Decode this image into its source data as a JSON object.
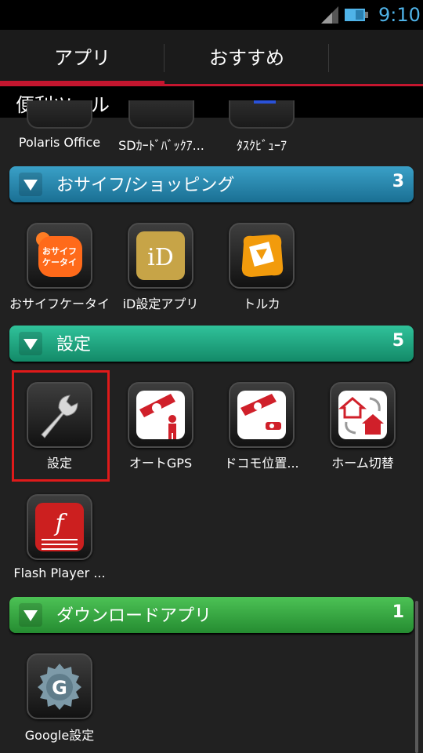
{
  "status": {
    "time": "9:10"
  },
  "tabs": [
    {
      "label": "アプリ"
    },
    {
      "label": "おすすめ"
    }
  ],
  "category_title": "便利ツール",
  "partial_row": [
    {
      "label": "Polaris Office"
    },
    {
      "label": "SDｶｰﾄﾞﾊﾞｯｸｱ..."
    },
    {
      "label": "ﾀｽｸﾋﾞｭｰｱ"
    }
  ],
  "groups": [
    {
      "name": "おサイフ/ショッピング",
      "count": "3",
      "color": "#1f7ea6",
      "apps": [
        {
          "label": "おサイフケータイ",
          "icon": "osaifu-keitai-icon",
          "icon_text": "おサイフケータイ"
        },
        {
          "label": "iD設定アプリ",
          "icon": "id-icon",
          "icon_text": "iD"
        },
        {
          "label": "トルカ",
          "icon": "toruca-icon"
        }
      ]
    },
    {
      "name": "設定",
      "count": "5",
      "color": "#1ba37c",
      "apps": [
        {
          "label": "設定",
          "icon": "wrench-icon"
        },
        {
          "label": "オートGPS",
          "icon": "auto-gps-icon"
        },
        {
          "label": "ドコモ位置...",
          "icon": "docomo-location-icon"
        },
        {
          "label": "ホーム切替",
          "icon": "home-switch-icon"
        },
        {
          "label": "Flash Player ...",
          "icon": "flash-player-icon"
        }
      ]
    },
    {
      "name": "ダウンロードアプリ",
      "count": "1",
      "color": "#2f9e3c",
      "apps": [
        {
          "label": "Google設定",
          "icon": "google-settings-icon",
          "icon_text": "G"
        }
      ]
    }
  ]
}
